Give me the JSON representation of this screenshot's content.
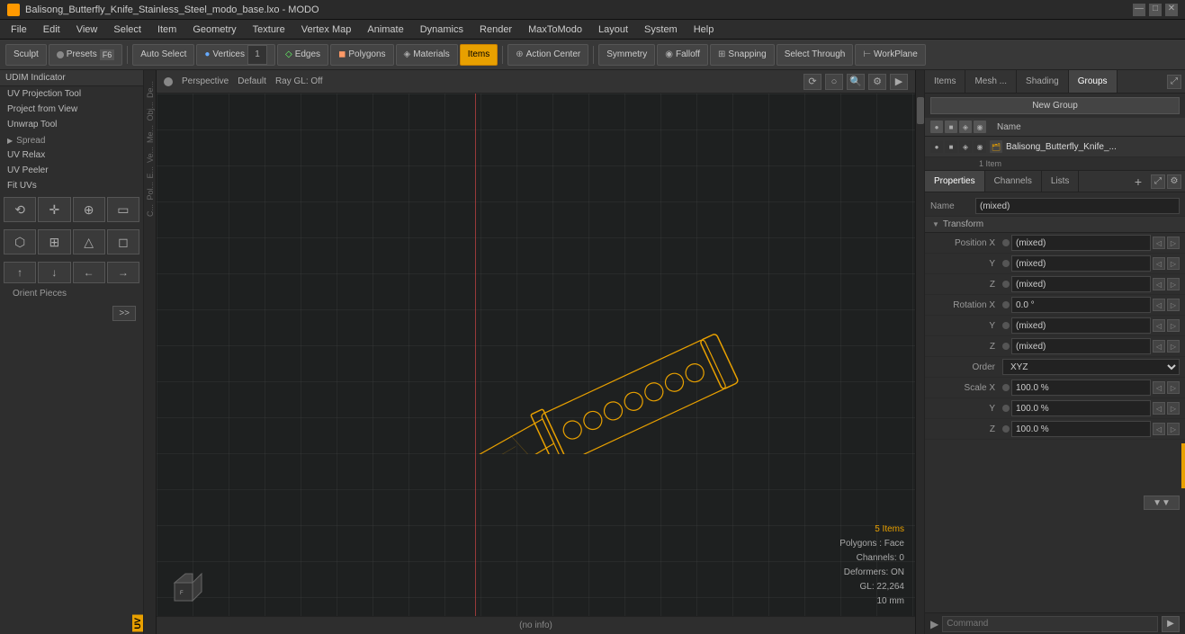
{
  "titlebar": {
    "title": "Balisong_Butterfly_Knife_Stainless_Steel_modo_base.lxo - MODO",
    "app_name": "MODO",
    "controls": [
      "—",
      "□",
      "✕"
    ]
  },
  "menubar": {
    "items": [
      "File",
      "Edit",
      "View",
      "Select",
      "Item",
      "Geometry",
      "Texture",
      "Vertex Map",
      "Animate",
      "Dynamics",
      "Render",
      "MaxToModo",
      "Layout",
      "System",
      "Help"
    ]
  },
  "toolbar": {
    "sculpt_label": "Sculpt",
    "presets_label": "Presets",
    "presets_key": "F6",
    "auto_select_label": "Auto Select",
    "vertices_label": "Vertices",
    "vertices_count": "1",
    "edges_label": "Edges",
    "polygons_label": "Polygons",
    "materials_label": "Materials",
    "items_label": "Items",
    "action_center_label": "Action Center",
    "symmetry_label": "Symmetry",
    "falloff_label": "Falloff",
    "snapping_label": "Snapping",
    "select_through_label": "Select Through",
    "workplane_label": "WorkPlane"
  },
  "left_panel": {
    "header": "UDIM Indicator",
    "items": [
      "UV Projection Tool",
      "Project from View",
      "Unwrap Tool"
    ],
    "spread_label": "Spread",
    "uv_relax_label": "UV Relax",
    "uv_peeler_label": "UV Peeler",
    "fit_uvs_label": "Fit UVs",
    "orient_label": "Orient Pieces",
    "expand_label": ">>"
  },
  "tools": {
    "row1": [
      "⟲",
      "◉",
      "⊕",
      "◻"
    ],
    "row2": [
      "⬡",
      "⊞",
      "△",
      "◻"
    ],
    "arrows": [
      "↑",
      "↓",
      "←",
      "→"
    ]
  },
  "vertical_labels": [
    "De...",
    "Obj...",
    "Me...",
    "Ve...",
    "E...",
    "Pol...",
    "C..."
  ],
  "viewport": {
    "indicator_color": "#888",
    "perspective_label": "Perspective",
    "default_label": "Default",
    "ray_gl_label": "Ray GL: Off",
    "controls": [
      "⟳",
      "◯",
      "🔍",
      "⚙",
      "▶"
    ]
  },
  "status": {
    "items_count": "5 Items",
    "polygons_label": "Polygons : Face",
    "channels": "Channels: 0",
    "deformers": "Deformers: ON",
    "gl_count": "GL: 22,264",
    "scale": "10 mm"
  },
  "bottom_bar": {
    "info": "(no info)"
  },
  "right_panel": {
    "tabs": [
      "Items",
      "Mesh ...",
      "Shading",
      "Groups"
    ],
    "active_tab": "Groups",
    "new_group_label": "New Group",
    "name_column": "Name",
    "group": {
      "icon": "🗂",
      "name": "Balisong_Butterfly_Knife_...",
      "count": "1 Item"
    }
  },
  "properties": {
    "tabs": [
      "Properties",
      "Channels",
      "Lists"
    ],
    "active_tab": "Properties",
    "add_btn": "+",
    "name_label": "Name",
    "name_value": "(mixed)",
    "transform_label": "Transform",
    "position_x_label": "Position X",
    "position_x_value": "(mixed)",
    "position_y_label": "Y",
    "position_y_value": "(mixed)",
    "position_z_label": "Z",
    "position_z_value": "(mixed)",
    "rotation_x_label": "Rotation X",
    "rotation_x_value": "0.0 °",
    "rotation_y_label": "Y",
    "rotation_y_value": "(mixed)",
    "rotation_z_label": "Z",
    "rotation_z_value": "(mixed)",
    "order_label": "Order",
    "order_value": "XYZ",
    "scale_x_label": "Scale X",
    "scale_x_value": "100.0 %",
    "scale_y_label": "Y",
    "scale_y_value": "100.0 %",
    "scale_z_label": "Z",
    "scale_z_value": "100.0 %"
  },
  "command": {
    "label": "Command",
    "placeholder": "Command"
  },
  "colors": {
    "accent": "#e8a000",
    "bg_dark": "#1e2020",
    "bg_mid": "#2e2e2e",
    "bg_light": "#383838",
    "border": "#222"
  }
}
